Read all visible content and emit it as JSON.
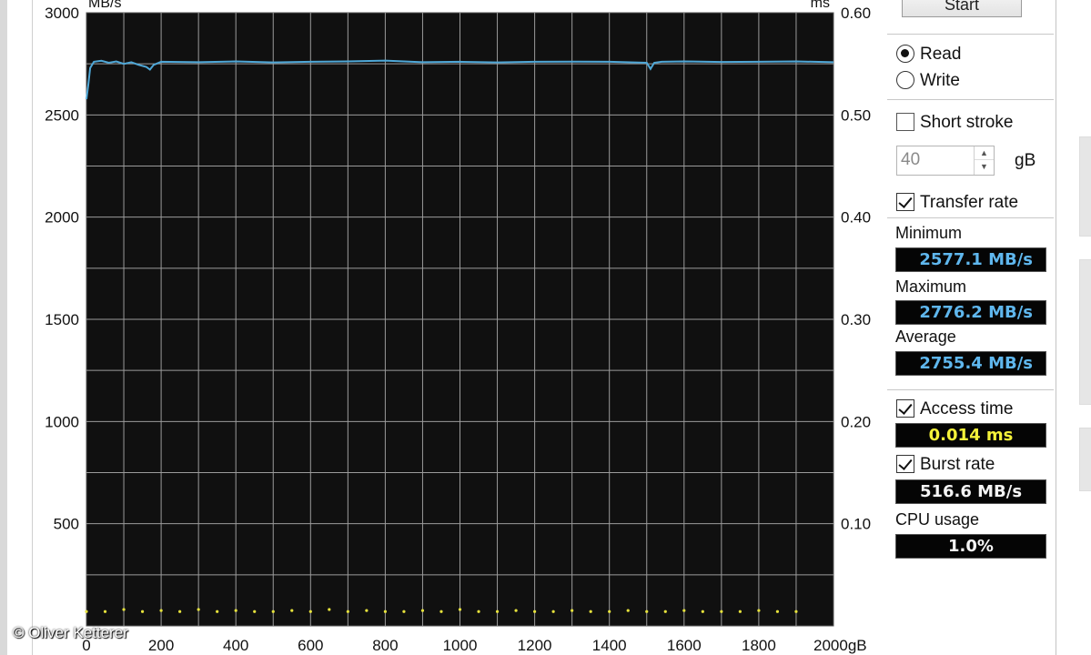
{
  "window": {
    "start_label": "Start"
  },
  "options": {
    "read_label": "Read",
    "write_label": "Write",
    "mode": "read",
    "short_stroke_label": "Short stroke",
    "short_stroke_checked": false,
    "short_stroke_value": "40",
    "short_stroke_unit": "gB",
    "transfer_rate_label": "Transfer rate",
    "transfer_rate_checked": true,
    "access_time_label": "Access time",
    "access_time_checked": true,
    "burst_rate_label": "Burst rate",
    "burst_rate_checked": true
  },
  "results": {
    "minimum_label": "Minimum",
    "minimum_value": "2577.1 MB/s",
    "maximum_label": "Maximum",
    "maximum_value": "2776.2 MB/s",
    "average_label": "Average",
    "average_value": "2755.4 MB/s",
    "access_time_value": "0.014 ms",
    "burst_rate_value": "516.6 MB/s",
    "cpu_usage_label": "CPU usage",
    "cpu_usage_value": "1.0%"
  },
  "watermark": "© Oliver Ketterer",
  "colors": {
    "plot_background": "#101010",
    "grid": "#9b9b9b",
    "transfer_line": "#4fa8d8",
    "access_points": "#e6e23c",
    "readout_blue": "#5fb7ee",
    "readout_yellow": "#f4f23a"
  },
  "chart_data": {
    "type": "line",
    "title": "",
    "xlabel": "gB",
    "ylabel": "MB/s",
    "y2label": "ms",
    "xlim": [
      0,
      2000
    ],
    "ylim": [
      0,
      3000
    ],
    "y2lim": [
      0,
      0.6
    ],
    "x_tick_labels": [
      "0",
      "200",
      "400",
      "600",
      "800",
      "1000",
      "1200",
      "1400",
      "1600",
      "1800",
      "2000gB"
    ],
    "y_tick_labels": [
      "3000",
      "2500",
      "2000",
      "1500",
      "1000",
      "500"
    ],
    "y2_tick_labels": [
      "0.60",
      "0.50",
      "0.40",
      "0.30",
      "0.20",
      "0.10"
    ],
    "y_tick_values": [
      3000,
      2500,
      2000,
      1500,
      1000,
      500
    ],
    "x_tick_values": [
      0,
      200,
      400,
      600,
      800,
      1000,
      1200,
      1400,
      1600,
      1800,
      2000
    ],
    "grid": true,
    "series": [
      {
        "kind": "line",
        "axis": "left",
        "color": "#4fa8d8",
        "x": [
          0,
          5,
          10,
          20,
          40,
          60,
          80,
          100,
          120,
          140,
          160,
          170,
          180,
          200,
          300,
          400,
          500,
          600,
          700,
          800,
          900,
          1000,
          1100,
          1200,
          1300,
          1400,
          1500,
          1510,
          1520,
          1540,
          1600,
          1700,
          1800,
          1900,
          2000
        ],
        "y": [
          2577,
          2650,
          2730,
          2760,
          2765,
          2755,
          2762,
          2750,
          2758,
          2745,
          2735,
          2722,
          2745,
          2760,
          2758,
          2762,
          2757,
          2760,
          2762,
          2766,
          2758,
          2760,
          2757,
          2760,
          2761,
          2760,
          2755,
          2725,
          2755,
          2760,
          2762,
          2759,
          2760,
          2762,
          2758
        ]
      },
      {
        "kind": "scatter",
        "axis": "right",
        "color": "#e6e23c",
        "x": [
          0,
          50,
          100,
          150,
          200,
          250,
          300,
          350,
          400,
          450,
          500,
          550,
          600,
          650,
          700,
          750,
          800,
          850,
          900,
          950,
          1000,
          1050,
          1100,
          1150,
          1200,
          1250,
          1300,
          1350,
          1400,
          1450,
          1500,
          1550,
          1600,
          1650,
          1700,
          1750,
          1800,
          1850,
          1900
        ],
        "y": [
          0.014,
          0.014,
          0.016,
          0.014,
          0.015,
          0.014,
          0.016,
          0.014,
          0.015,
          0.014,
          0.014,
          0.015,
          0.014,
          0.016,
          0.014,
          0.015,
          0.014,
          0.014,
          0.015,
          0.014,
          0.016,
          0.014,
          0.014,
          0.015,
          0.014,
          0.014,
          0.015,
          0.014,
          0.014,
          0.015,
          0.014,
          0.014,
          0.015,
          0.014,
          0.014,
          0.014,
          0.015,
          0.014,
          0.014
        ]
      }
    ]
  }
}
